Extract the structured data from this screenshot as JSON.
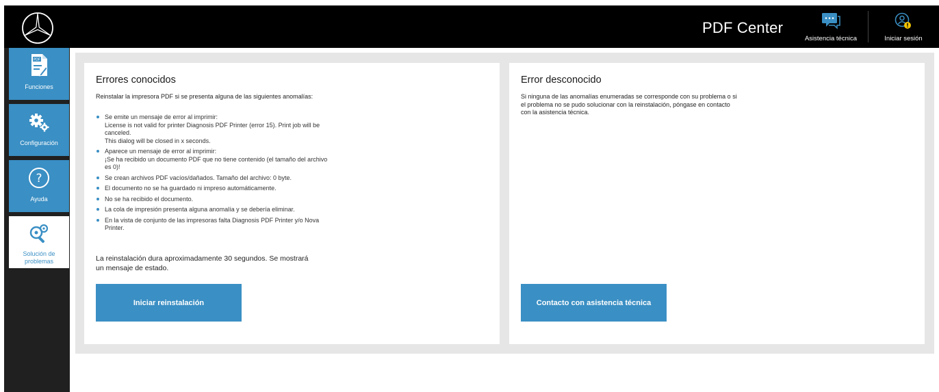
{
  "header": {
    "title": "PDF Center",
    "support_label": "Asistencia técnica",
    "login_label": "Iniciar sesión"
  },
  "sidebar": {
    "items": [
      {
        "label": "Funciones",
        "icon": "pdf-document-icon"
      },
      {
        "label": "Configuración",
        "icon": "gears-icon"
      },
      {
        "label": "Ayuda",
        "icon": "question-icon"
      },
      {
        "label": "Solución de problemas",
        "icon": "troubleshoot-icon",
        "active": true
      }
    ]
  },
  "known_errors": {
    "title": "Errores conocidos",
    "intro": "Reinstalar la impresora PDF si se presenta alguna de las siguientes anomalías:",
    "items": [
      "Se emite un mensaje de error al imprimir:",
      "Aparece un mensaje de error al imprimir:",
      "Se crean archivos PDF vacíos/dañados. Tamaño del archivo: 0 byte.",
      "El documento no se ha guardado ni impreso automáticamente.",
      "No se ha recibido el documento.",
      "La cola de impresión presenta alguna anomalía y se debería eliminar.",
      "En la vista de conjunto de las impresoras falta Diagnosis PDF Printer y/o Nova Printer."
    ],
    "item0_detail1": "License is not valid for printer Diagnosis PDF Printer (error 15). Print job will be canceled.",
    "item0_detail2": "This dialog will be closed in x seconds.",
    "item1_detail": "¡Se ha recibido un documento PDF que no tiene contenido (el tamaño del archivo es 0)!",
    "outro": "La reinstalación dura aproximadamente 30 segundos. Se mostrará un mensaje de estado.",
    "button": "Iniciar reinstalación"
  },
  "unknown_error": {
    "title": "Error desconocido",
    "text": "Si ninguna de las anomalías enumeradas se corresponde con su problema o si el problema no se pudo solucionar con la reinstalación, póngase en contacto con la asistencia técnica.",
    "button": "Contacto con asistencia técnica"
  },
  "colors": {
    "accent": "#3a8fc4",
    "topbar": "#000000",
    "sidebar": "#202020",
    "main_bg": "#e6e6e6"
  }
}
